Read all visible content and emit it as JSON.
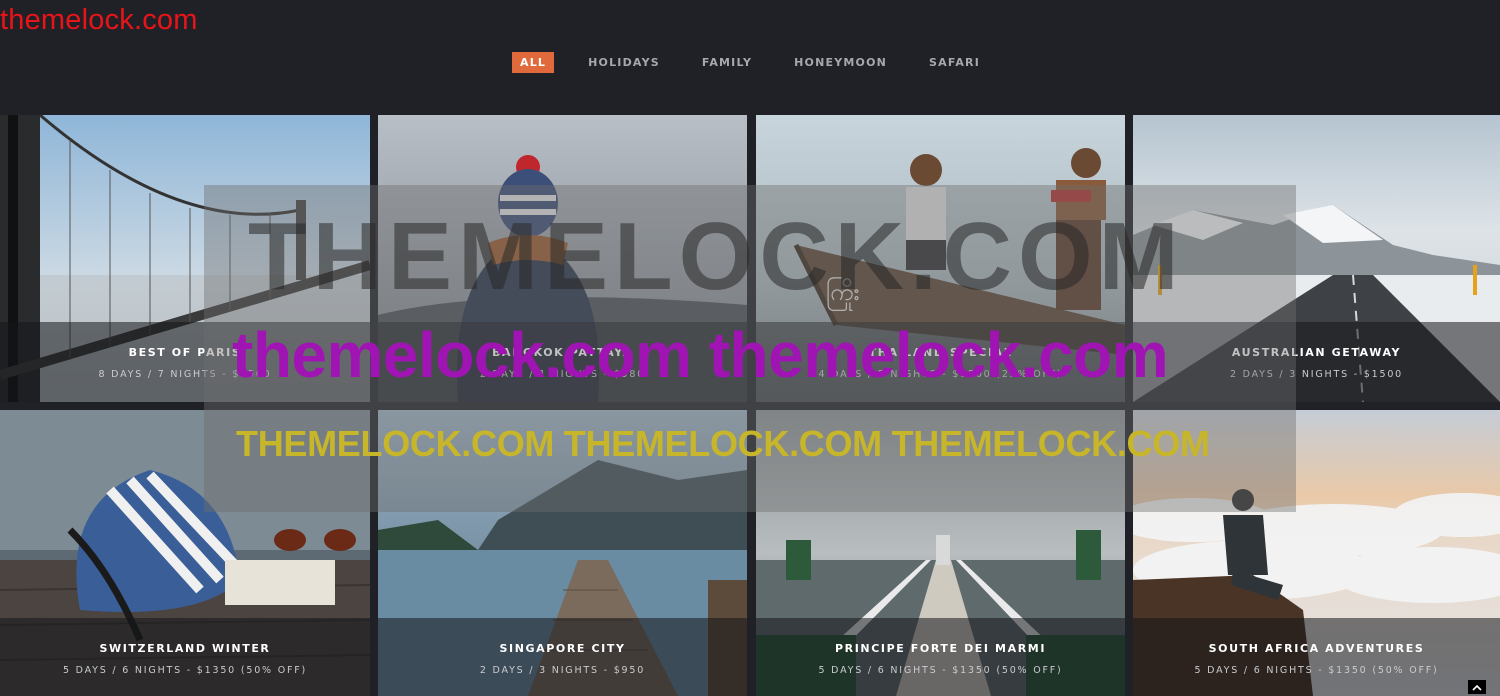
{
  "watermark_corner": "themelock.com",
  "filters": [
    "ALL",
    "HOLIDAYS",
    "FAMILY",
    "HONEYMOON",
    "SAFARI"
  ],
  "active_filter": "ALL",
  "accent_color": "#e06a3b",
  "tiles": [
    {
      "title": "BEST OF PARIS",
      "subtitle": "8 DAYS / 7 NIGHTS - $2500",
      "image": "suspension-bridge"
    },
    {
      "title": "BANGKOK PATTAYA",
      "subtitle": "2 DAYS / 1 NIGHTS - $580",
      "image": "person-in-beanie"
    },
    {
      "title": "THAILAND SPECIAL",
      "subtitle": "4 DAYS / 5 NIGHTS - $1500 (22% OFF)",
      "image": "boys-on-boat"
    },
    {
      "title": "AUSTRALIAN GETAWAY",
      "subtitle": "2 DAYS / 3 NIGHTS - $1500",
      "image": "snowy-road"
    },
    {
      "title": "SWITZERLAND WINTER",
      "subtitle": "5 DAYS / 6 NIGHTS - $1350 (50% OFF)",
      "image": "bag-and-sunglasses"
    },
    {
      "title": "SINGAPORE CITY",
      "subtitle": "2 DAYS / 3 NIGHTS - $950",
      "image": "lake-pier"
    },
    {
      "title": "PRINCIPE FORTE DEI MARMI",
      "subtitle": "5 DAYS / 6 NIGHTS - $1350 (50% OFF)",
      "image": "pier-walkway"
    },
    {
      "title": "SOUTH AFRICA ADVENTURES",
      "subtitle": "5 DAYS / 6 NIGHTS - $1350 (50% OFF)",
      "image": "man-above-clouds"
    }
  ],
  "watermark": {
    "big": "THEMELOCK.COM",
    "purple": "themelock.com themelock.com",
    "yellow": "THEMELOCK.COM THEMELOCK.COM THEMELOCK.COM"
  },
  "scroll_top_icon": "chevron-up-icon"
}
